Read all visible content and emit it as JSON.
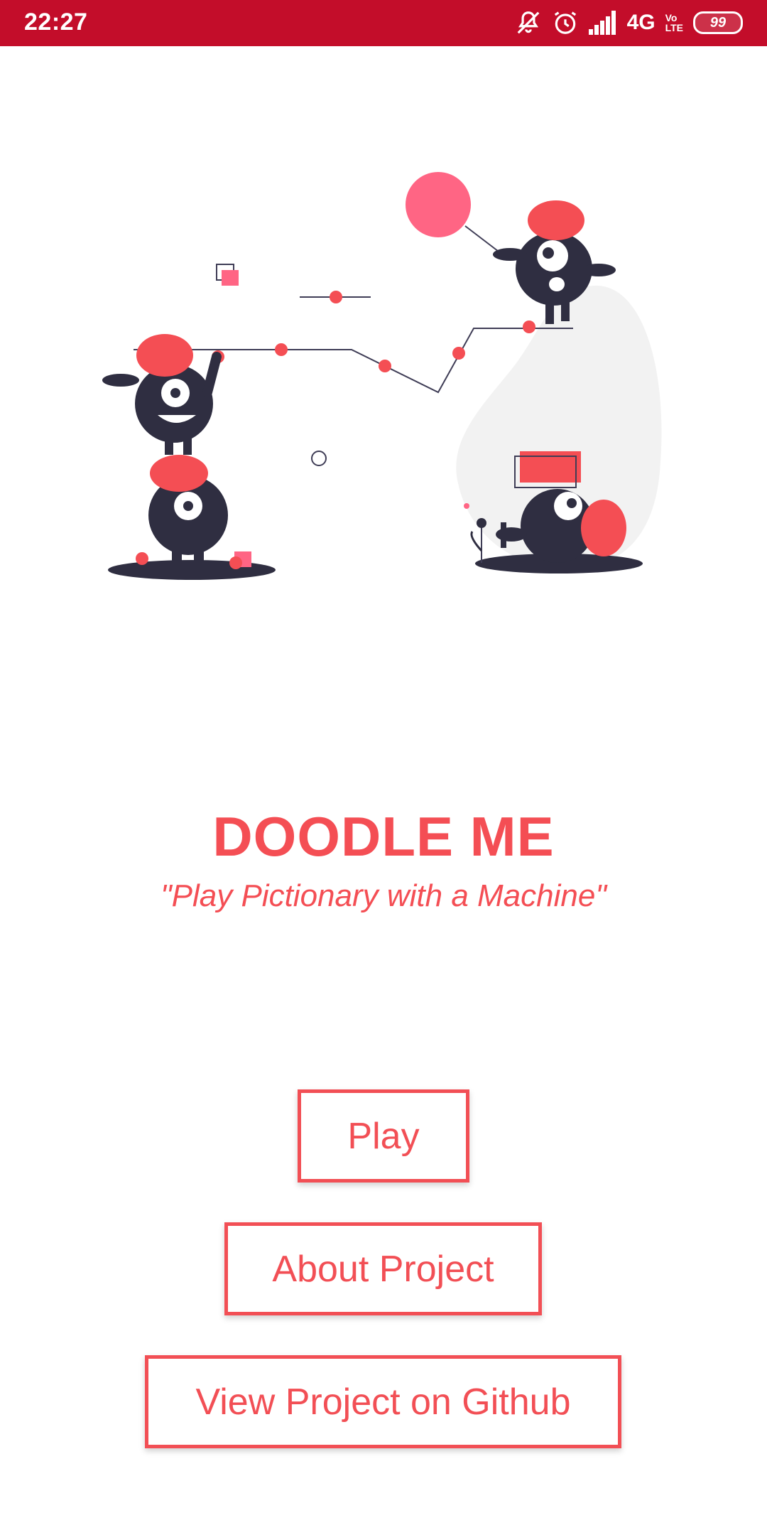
{
  "status_bar": {
    "time": "22:27",
    "network": "4G",
    "volte_top": "Vo",
    "volte_bottom": "LTE",
    "battery": "99",
    "icons": [
      "notifications-off-icon",
      "alarm-icon",
      "signal-icon",
      "battery-icon"
    ]
  },
  "app": {
    "title": "DOODLE ME",
    "tagline": "\"Play Pictionary with a Machine\""
  },
  "buttons": {
    "play": "Play",
    "about": "About Project",
    "github": "View Project on Github"
  },
  "colors": {
    "status_bar": "#c30d2a",
    "accent": "#f44e54",
    "figure_dark": "#2f2e41",
    "balloon_pink": "#ff6584"
  }
}
